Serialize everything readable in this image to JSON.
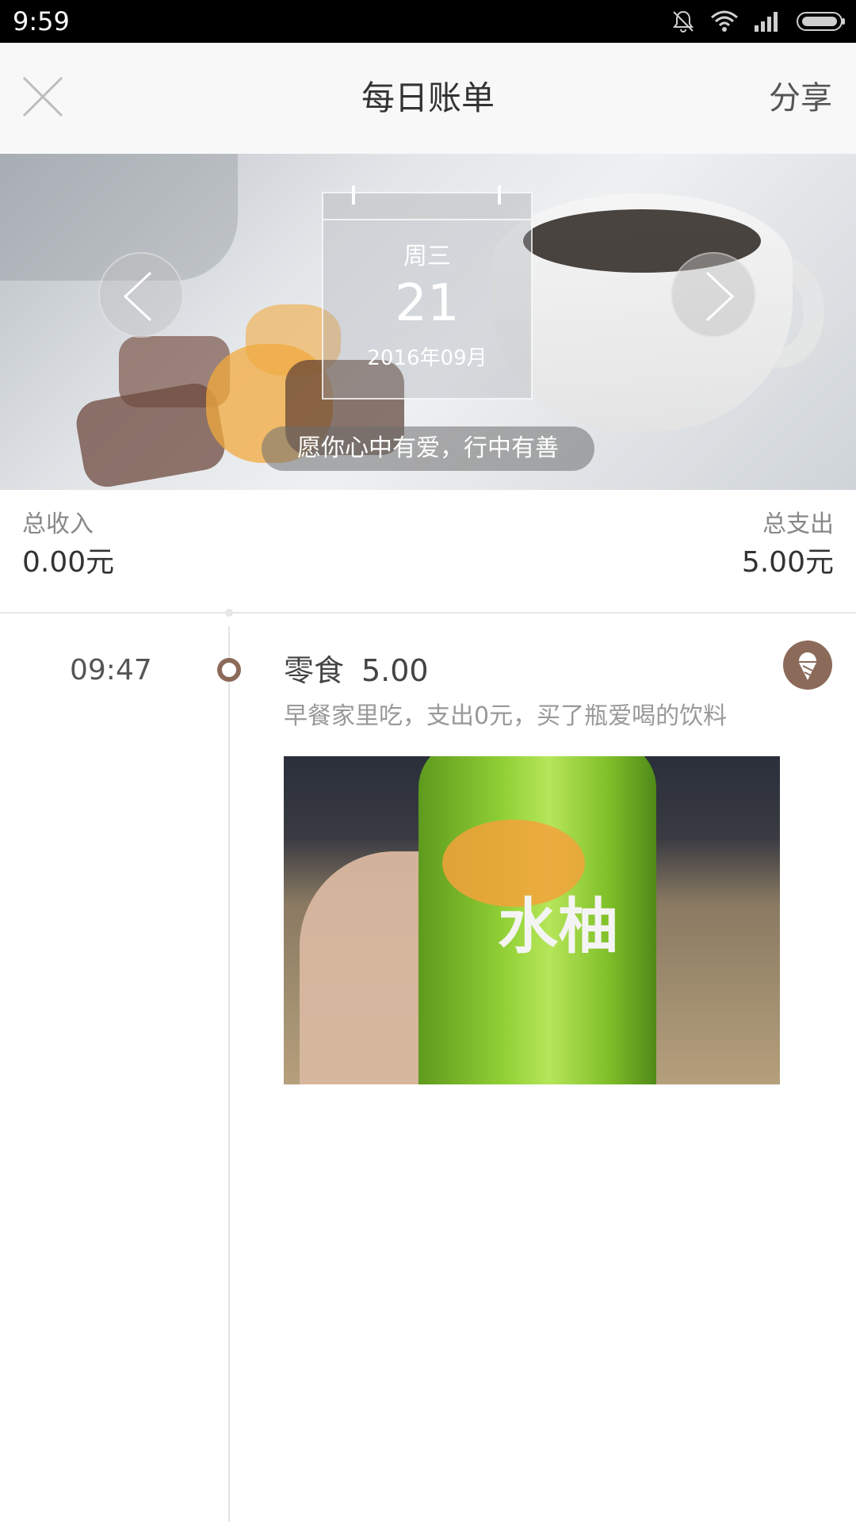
{
  "status_bar": {
    "time": "9:59",
    "icons": [
      "mute-bell-icon",
      "wifi-icon",
      "signal-icon",
      "battery-icon"
    ]
  },
  "header": {
    "title": "每日账单",
    "share_label": "分享",
    "close_icon": "close-icon"
  },
  "banner": {
    "weekday": "周三",
    "day": "21",
    "month": "2016年09月",
    "motto": "愿你心中有爱，行中有善",
    "prev_icon": "chevron-left-icon",
    "next_icon": "chevron-right-icon"
  },
  "summary": {
    "income_label": "总收入",
    "income_value": "0.00元",
    "expense_label": "总支出",
    "expense_value": "5.00元"
  },
  "entries": [
    {
      "time": "09:47",
      "category": "零食",
      "amount": "5.00",
      "note": "早餐家里吃，支出0元，买了瓶爱喝的饮料",
      "category_icon": "ice-cream-icon",
      "photo_text": "水柚",
      "accent_color": "#8c6a5a"
    }
  ]
}
